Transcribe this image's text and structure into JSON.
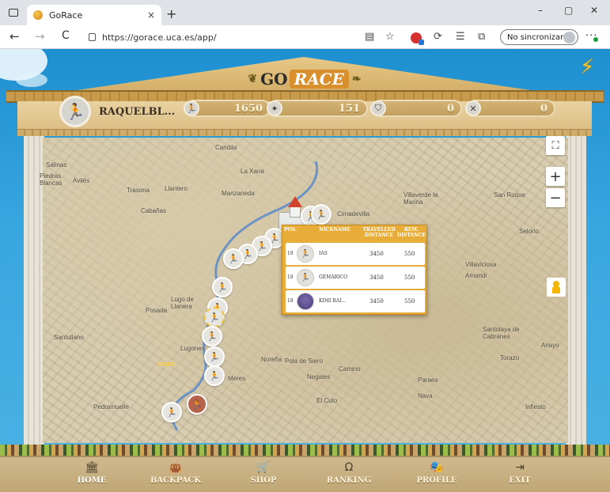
{
  "browser": {
    "tab_title": "GoRace",
    "tab_close": "×",
    "new_tab": "+",
    "url": "https://gorace.uca.es/app/",
    "sync_label": "No sincronizando",
    "window_minimize": "–",
    "window_maximize": "▢",
    "window_close": "✕",
    "back": "←",
    "forward": "→",
    "refresh": "C",
    "more": "···"
  },
  "game": {
    "logo_go": "GO",
    "logo_race": "RACE",
    "player": {
      "nickname": "RAQUELBL...",
      "stats": [
        {
          "icon": "runner-icon",
          "glyph": "🏃",
          "value": "1650"
        },
        {
          "icon": "compass-icon",
          "glyph": "✦",
          "value": "151"
        },
        {
          "icon": "helmet-icon",
          "glyph": "⛉",
          "value": "0"
        },
        {
          "icon": "swords-icon",
          "glyph": "✕",
          "value": "0"
        }
      ]
    },
    "map": {
      "labels": [
        "Candás",
        "La Xana",
        "Avilés",
        "Trasona",
        "Llantero",
        "Manzaneda",
        "Cabañas",
        "Cimadevilla",
        "Villaverde la Marina",
        "San Roque",
        "Selorio",
        "Villaviciosa",
        "Amandi",
        "Lugo de Llanera",
        "Posada",
        "Lugones",
        "Noreña",
        "Pola de Siero",
        "Camino",
        "Negales",
        "Meres",
        "Paraes",
        "Nava",
        "Santullano",
        "Santolaya de Cabranes",
        "Torazo",
        "Anayo",
        "Piedras Blancas",
        "Salinas",
        "El Cuto",
        "Pedramuelle",
        "Infiesto"
      ],
      "fullscreen": "⛶",
      "zoom_in": "+",
      "zoom_out": "−",
      "start_label": "START"
    },
    "ranking": {
      "headers": {
        "pos": "POS.",
        "nickname": "NICKNAME",
        "travelled": "TRAVELLED DISTANCE",
        "remaining": "REM. DISTANCE"
      },
      "rows": [
        {
          "pos": "18",
          "name": "IAS",
          "travelled": "3450",
          "remaining": "550"
        },
        {
          "pos": "18",
          "name": "GEMARICO",
          "travelled": "3450",
          "remaining": "550"
        },
        {
          "pos": "18",
          "name": "KIMI RAI...",
          "travelled": "3450",
          "remaining": "550"
        }
      ]
    },
    "nav": [
      {
        "label": "HOME",
        "icon": "🏛"
      },
      {
        "label": "BACKPACK",
        "icon": "👜"
      },
      {
        "label": "SHOP",
        "icon": "🛒"
      },
      {
        "label": "RANKING",
        "icon": "Ω"
      },
      {
        "label": "PROFILE",
        "icon": "🎭"
      },
      {
        "label": "EXIT",
        "icon": "⇥"
      }
    ]
  },
  "colors": {
    "sky": "#38a6df",
    "gold": "#e8ad38",
    "temple": "#d2ad66",
    "map": "#d8cdb1",
    "river": "#5b8ac9"
  }
}
